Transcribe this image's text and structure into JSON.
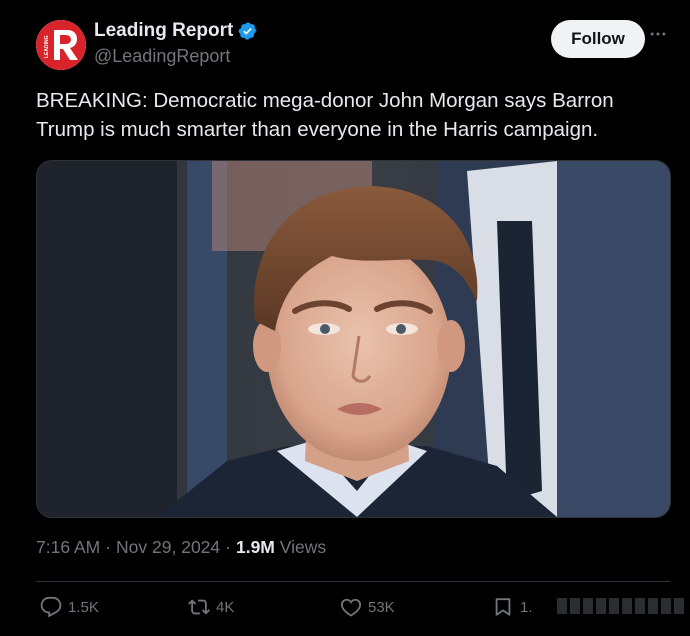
{
  "author": {
    "display_name": "Leading Report",
    "handle": "@LeadingReport",
    "avatar_letter": "R",
    "avatar_text": "LEADING",
    "brand_color": "#d8232a",
    "verified_color": "#1d9bf0"
  },
  "follow_label": "Follow",
  "tweet_text": "BREAKING: Democratic mega-donor John Morgan says Barron Trump is much smarter than everyone in the Harris campaign.",
  "meta": {
    "time": "7:16 AM",
    "sep1": "·",
    "date": "Nov 29, 2024",
    "sep2": "·",
    "views_count": "1.9M",
    "views_label": "Views"
  },
  "actions": {
    "replies": "1.5K",
    "reposts": "4K",
    "likes": "53K",
    "bookmarks": "1."
  },
  "icons": {
    "avatar": "leading-report-logo",
    "verified": "verified-badge-icon",
    "more": "more-icon",
    "reply": "reply-icon",
    "repost": "repost-icon",
    "like": "like-icon",
    "bookmark": "bookmark-icon"
  }
}
